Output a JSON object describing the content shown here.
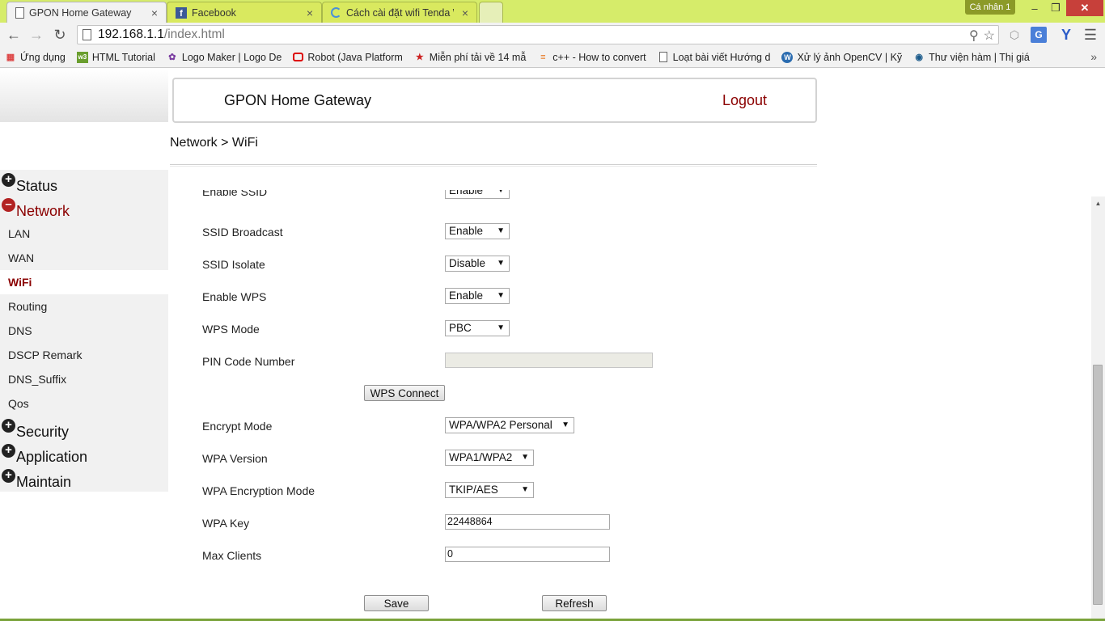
{
  "browser": {
    "tabs": [
      {
        "title": "GPON Home Gateway",
        "close": "×"
      },
      {
        "title": "Facebook",
        "close": "×"
      },
      {
        "title": "Cách cài đặt wifi Tenda W",
        "close": "×"
      }
    ],
    "profile": "Cá nhân 1",
    "window_controls": {
      "minimize": "–",
      "maximize": "❐",
      "close": "✕"
    },
    "url_host": "192.168.1.1",
    "url_path": "/index.html",
    "bookmarks": [
      {
        "label": "Ứng dụng",
        "icon": "apps-grid-icon"
      },
      {
        "label": "HTML Tutorial",
        "icon": "w3-icon"
      },
      {
        "label": "Logo Maker | Logo De",
        "icon": "logo-maker-icon"
      },
      {
        "label": "Robot (Java Platform",
        "icon": "oracle-icon"
      },
      {
        "label": "Miễn phí tải về 14 mẫ",
        "icon": "star-icon"
      },
      {
        "label": "c++ - How to convert",
        "icon": "stackoverflow-icon"
      },
      {
        "label": "Loạt bài viết Hướng d",
        "icon": "page-icon"
      },
      {
        "label": "Xử lý ảnh OpenCV | Kỹ",
        "icon": "wordpress-icon"
      },
      {
        "label": "Thư viện hàm | Thị giá",
        "icon": "target-icon"
      }
    ]
  },
  "header": {
    "title": "GPON Home Gateway",
    "logout": "Logout"
  },
  "breadcrumb": "Network > WiFi",
  "sidebar": {
    "items": [
      {
        "label": "Status",
        "type": "top",
        "open": false
      },
      {
        "label": "Network",
        "type": "top",
        "open": true
      },
      {
        "label": "LAN",
        "type": "sub"
      },
      {
        "label": "WAN",
        "type": "sub"
      },
      {
        "label": "WiFi",
        "type": "sub",
        "active": true
      },
      {
        "label": "Routing",
        "type": "sub"
      },
      {
        "label": "DNS",
        "type": "sub"
      },
      {
        "label": "DSCP Remark",
        "type": "sub"
      },
      {
        "label": "DNS_Suffix",
        "type": "sub"
      },
      {
        "label": "Qos",
        "type": "sub"
      },
      {
        "label": "Security",
        "type": "top",
        "open": false
      },
      {
        "label": "Application",
        "type": "top",
        "open": false
      },
      {
        "label": "Maintain",
        "type": "top",
        "open": false
      }
    ]
  },
  "form": {
    "enable_ssid": {
      "label": "Enable SSID",
      "value": "Enable"
    },
    "ssid_broadcast": {
      "label": "SSID Broadcast",
      "value": "Enable"
    },
    "ssid_isolate": {
      "label": "SSID Isolate",
      "value": "Disable"
    },
    "enable_wps": {
      "label": "Enable WPS",
      "value": "Enable"
    },
    "wps_mode": {
      "label": "WPS Mode",
      "value": "PBC"
    },
    "pin_code": {
      "label": "PIN Code Number",
      "value": ""
    },
    "wps_connect": "WPS Connect",
    "encrypt_mode": {
      "label": "Encrypt Mode",
      "value": "WPA/WPA2 Personal"
    },
    "wpa_version": {
      "label": "WPA Version",
      "value": "WPA1/WPA2"
    },
    "wpa_encryption": {
      "label": "WPA Encryption Mode",
      "value": "TKIP/AES"
    },
    "wpa_key": {
      "label": "WPA Key",
      "value": "22448864"
    },
    "max_clients": {
      "label": "Max Clients",
      "value": "0"
    },
    "save": "Save",
    "refresh": "Refresh"
  },
  "colors": {
    "accent": "#8b0000",
    "tabstrip": "#d6ec6a"
  }
}
